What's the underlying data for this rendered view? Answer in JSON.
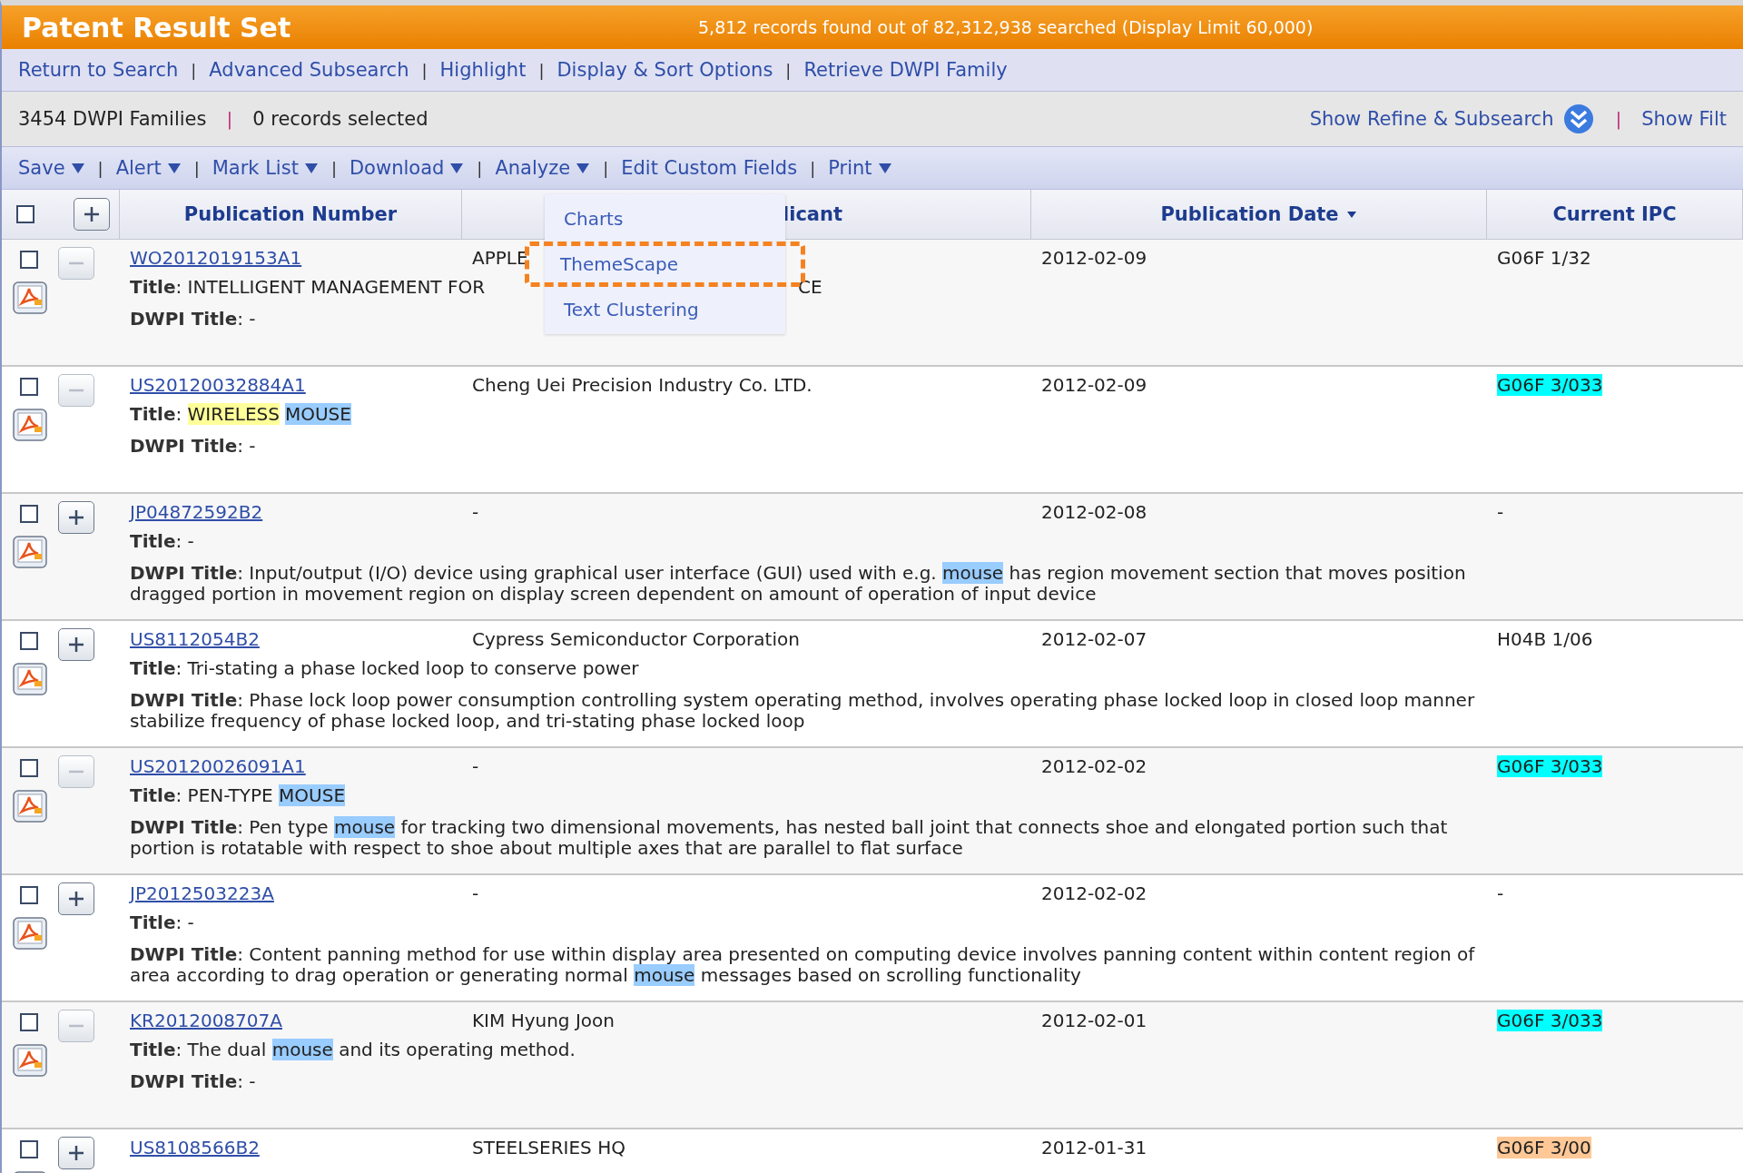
{
  "title_bar": {
    "title": "Patent Result Set",
    "summary": "5,812 records found out of 82,312,938 searched (Display Limit 60,000)"
  },
  "separator": "|",
  "nav_links": [
    "Return to Search",
    "Advanced Subsearch",
    "Highlight",
    "Display & Sort Options",
    "Retrieve DWPI Family"
  ],
  "info_bar": {
    "families": "3454 DWPI Families",
    "selected_count": "0 records selected",
    "refine_link": "Show Refine & Subsearch",
    "filter_link": "Show Filt"
  },
  "toolbar": [
    {
      "label": "Save",
      "has_menu": true
    },
    {
      "label": "Alert",
      "has_menu": true
    },
    {
      "label": "Mark List",
      "has_menu": true
    },
    {
      "label": "Download",
      "has_menu": true
    },
    {
      "label": "Analyze",
      "has_menu": true
    },
    {
      "label": "Edit Custom Fields",
      "has_menu": false
    },
    {
      "label": "Print",
      "has_menu": true
    }
  ],
  "analyze_menu": [
    {
      "label": "Charts",
      "marked": false
    },
    {
      "label": "ThemeScape",
      "marked": true
    },
    {
      "label": "Text Clustering",
      "marked": false
    }
  ],
  "table": {
    "select_all_checked": false,
    "expand_all_expanded": false,
    "columns": [
      {
        "label": "Publication Number",
        "sorted": false
      },
      {
        "label": "licant",
        "sorted": false
      },
      {
        "label": "Publication Date",
        "sorted": true
      },
      {
        "label": "Current IPC",
        "sorted": false
      }
    ],
    "rows": [
      {
        "checked": false,
        "expanded": true,
        "number": "WO2012019153A1",
        "applicant": "APPLE",
        "date": "2012-02-09",
        "ipc": {
          "text": "G06F 1/32"
        },
        "title_label": "Title",
        "title": [
          {
            "text": ": INTELLIGENT MANAGEMENT FOR"
          }
        ],
        "title_tail": "CE",
        "dwpi_label": "DWPI Title",
        "dwpi": [
          [
            {
              "text": ": -"
            }
          ]
        ]
      },
      {
        "checked": false,
        "expanded": true,
        "number": "US20120032884A1",
        "applicant": "Cheng Uei Precision Industry Co. LTD.",
        "date": "2012-02-09",
        "ipc": {
          "text": "G06F 3/033",
          "color": "#00ffff"
        },
        "title_label": "Title",
        "title": [
          {
            "text": ": "
          },
          {
            "text": "WIRELESS",
            "color": "#ffff99"
          },
          {
            "text": "MOUSE",
            "color": "#99ccff"
          }
        ],
        "dwpi_label": "DWPI Title",
        "dwpi": [
          [
            {
              "text": ": -"
            }
          ]
        ]
      },
      {
        "checked": false,
        "expanded": false,
        "number": "JP04872592B2",
        "applicant": "-",
        "date": "2012-02-08",
        "ipc": {
          "text": "-"
        },
        "title_label": "Title",
        "title": [
          {
            "text": ": -"
          }
        ],
        "dwpi_label": "DWPI Title",
        "dwpi": [
          [
            {
              "text": ": Input/output (I/O) device using graphical user interface (GUI) used with e.g. "
            },
            {
              "text": "mouse",
              "color": "#99ccff"
            },
            {
              "text": " has region movement section that moves position"
            }
          ],
          [
            {
              "text": "dragged portion in movement region on display screen dependent on amount of operation of input device"
            }
          ]
        ]
      },
      {
        "checked": false,
        "expanded": false,
        "number": "US8112054B2",
        "applicant": "Cypress Semiconductor Corporation",
        "date": "2012-02-07",
        "ipc": {
          "text": "H04B 1/06"
        },
        "title_label": "Title",
        "title": [
          {
            "text": ": Tri-stating a phase locked loop to conserve power"
          }
        ],
        "dwpi_label": "DWPI Title",
        "dwpi": [
          [
            {
              "text": ": Phase lock loop power consumption controlling system operating method, involves operating phase locked loop in closed loop manner"
            }
          ],
          [
            {
              "text": "stabilize frequency of phase locked loop, and tri-stating phase locked loop"
            }
          ]
        ]
      },
      {
        "checked": false,
        "expanded": true,
        "number": "US20120026091A1",
        "applicant": "-",
        "date": "2012-02-02",
        "ipc": {
          "text": "G06F 3/033",
          "color": "#00ffff"
        },
        "title_label": "Title",
        "title": [
          {
            "text": ": PEN-TYPE "
          },
          {
            "text": "MOUSE",
            "color": "#99ccff"
          }
        ],
        "dwpi_label": "DWPI Title",
        "dwpi": [
          [
            {
              "text": ": Pen type "
            },
            {
              "text": "mouse",
              "color": "#99ccff"
            },
            {
              "text": " for tracking two dimensional movements, has nested ball joint that connects shoe and elongated portion such that"
            }
          ],
          [
            {
              "text": "portion is rotatable with respect to shoe about multiple axes that are parallel to flat surface"
            }
          ]
        ]
      },
      {
        "checked": false,
        "expanded": false,
        "number": "JP2012503223A",
        "applicant": "-",
        "date": "2012-02-02",
        "ipc": {
          "text": "-"
        },
        "title_label": "Title",
        "title": [
          {
            "text": ": -"
          }
        ],
        "dwpi_label": "DWPI Title",
        "dwpi": [
          [
            {
              "text": ": Content panning method for use within display area presented on computing device involves panning content within content region of"
            }
          ],
          [
            {
              "text": "area according to drag operation or generating normal "
            },
            {
              "text": "mouse",
              "color": "#99ccff"
            },
            {
              "text": " messages based on scrolling functionality"
            }
          ]
        ]
      },
      {
        "checked": false,
        "expanded": true,
        "number": "KR2012008707A",
        "applicant": "KIM Hyung Joon",
        "date": "2012-02-01",
        "ipc": {
          "text": "G06F 3/033",
          "color": "#00ffff"
        },
        "title_label": "Title",
        "title": [
          {
            "text": ": The dual "
          },
          {
            "text": "mouse",
            "color": "#99ccff"
          },
          {
            "text": " and its operating method."
          }
        ],
        "dwpi_label": "DWPI Title",
        "dwpi": [
          [
            {
              "text": ": -"
            }
          ]
        ]
      },
      {
        "checked": false,
        "expanded": false,
        "number": "US8108566B2",
        "applicant": "STEELSERIES HQ",
        "date": "2012-01-31",
        "ipc": {
          "text": "G06F 3/00",
          "color": "#ffc896"
        }
      }
    ]
  }
}
